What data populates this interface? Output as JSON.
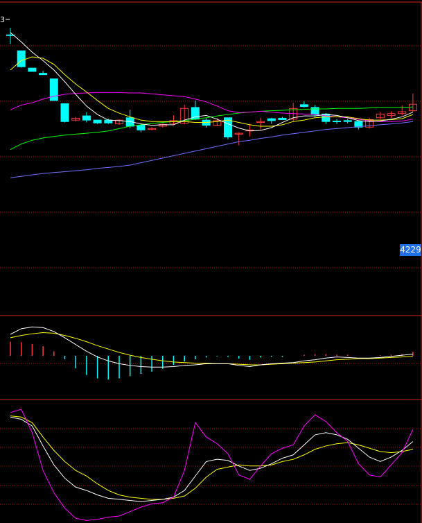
{
  "price_tag": "4229",
  "corner_glyph": "3",
  "colors": {
    "background": "#000000",
    "frame": "#d42424",
    "grid": "#a01818",
    "up_candle": "#ff3a3a",
    "down_candle": "#00ffff",
    "ma5": "#ffffff",
    "ma10": "#ffff00",
    "ma20": "#ff00ff",
    "ma30": "#00ff00",
    "ma60": "#7070ff",
    "price_tag_bg": "#1e6fe8"
  },
  "chart_data": [
    {
      "type": "candlestick",
      "panel": "main",
      "candles": [
        {
          "o": 4495,
          "h": 4510,
          "l": 4476,
          "c": 4495
        },
        {
          "o": 4461,
          "h": 4461,
          "l": 4425,
          "c": 4427
        },
        {
          "o": 4424,
          "h": 4424,
          "l": 4418,
          "c": 4417
        },
        {
          "o": 4413,
          "h": 4418,
          "l": 4410,
          "c": 4410
        },
        {
          "o": 4401,
          "h": 4401,
          "l": 4355,
          "c": 4355
        },
        {
          "o": 4348,
          "h": 4348,
          "l": 4308,
          "c": 4310
        },
        {
          "o": 4313,
          "h": 4320,
          "l": 4310,
          "c": 4317
        },
        {
          "o": 4322,
          "h": 4330,
          "l": 4308,
          "c": 4313
        },
        {
          "o": 4313,
          "h": 4313,
          "l": 4305,
          "c": 4307
        },
        {
          "o": 4313,
          "h": 4316,
          "l": 4305,
          "c": 4307
        },
        {
          "o": 4305,
          "h": 4315,
          "l": 4303,
          "c": 4313
        },
        {
          "o": 4318,
          "h": 4335,
          "l": 4296,
          "c": 4300
        },
        {
          "o": 4302,
          "h": 4305,
          "l": 4287,
          "c": 4292
        },
        {
          "o": 4293,
          "h": 4298,
          "l": 4291,
          "c": 4295
        },
        {
          "o": 4300,
          "h": 4306,
          "l": 4297,
          "c": 4304
        },
        {
          "o": 4306,
          "h": 4323,
          "l": 4302,
          "c": 4312
        },
        {
          "o": 4306,
          "h": 4346,
          "l": 4304,
          "c": 4338
        },
        {
          "o": 4340,
          "h": 4355,
          "l": 4313,
          "c": 4315
        },
        {
          "o": 4313,
          "h": 4318,
          "l": 4297,
          "c": 4302
        },
        {
          "o": 4302,
          "h": 4318,
          "l": 4300,
          "c": 4312
        },
        {
          "o": 4318,
          "h": 4318,
          "l": 4272,
          "c": 4277
        },
        {
          "o": 4283,
          "h": 4287,
          "l": 4259,
          "c": 4285
        },
        {
          "o": 4290,
          "h": 4305,
          "l": 4278,
          "c": 4292
        },
        {
          "o": 4308,
          "h": 4318,
          "l": 4293,
          "c": 4310
        },
        {
          "o": 4316,
          "h": 4318,
          "l": 4305,
          "c": 4312
        },
        {
          "o": 4317,
          "h": 4320,
          "l": 4313,
          "c": 4314
        },
        {
          "o": 4315,
          "h": 4350,
          "l": 4311,
          "c": 4338
        },
        {
          "o": 4346,
          "h": 4353,
          "l": 4340,
          "c": 4342
        },
        {
          "o": 4340,
          "h": 4345,
          "l": 4320,
          "c": 4325
        },
        {
          "o": 4326,
          "h": 4328,
          "l": 4305,
          "c": 4310
        },
        {
          "o": 4311,
          "h": 4315,
          "l": 4305,
          "c": 4310
        },
        {
          "o": 4312,
          "h": 4316,
          "l": 4306,
          "c": 4310
        },
        {
          "o": 4310,
          "h": 4312,
          "l": 4293,
          "c": 4298
        },
        {
          "o": 4298,
          "h": 4318,
          "l": 4295,
          "c": 4314
        },
        {
          "o": 4318,
          "h": 4330,
          "l": 4315,
          "c": 4326
        },
        {
          "o": 4323,
          "h": 4332,
          "l": 4318,
          "c": 4327
        },
        {
          "o": 4327,
          "h": 4344,
          "l": 4323,
          "c": 4331
        },
        {
          "o": 4333,
          "h": 4370,
          "l": 4330,
          "c": 4347
        }
      ],
      "ma5": [
        4500,
        4480,
        4458,
        4440,
        4420,
        4395,
        4368,
        4343,
        4325,
        4313,
        4312,
        4310,
        4305,
        4302,
        4303,
        4303,
        4313,
        4320,
        4323,
        4315,
        4305,
        4296,
        4290,
        4291,
        4297,
        4308,
        4318,
        4322,
        4322,
        4325,
        4323,
        4318,
        4312,
        4310,
        4311,
        4315,
        4320,
        4330
      ],
      "ma10": [
        4420,
        4440,
        4448,
        4445,
        4432,
        4410,
        4390,
        4373,
        4355,
        4338,
        4328,
        4320,
        4313,
        4310,
        4310,
        4310,
        4310,
        4308,
        4308,
        4310,
        4313,
        4308,
        4303,
        4300,
        4300,
        4303,
        4310,
        4313,
        4318,
        4320,
        4320,
        4320,
        4316,
        4313,
        4313,
        4314,
        4316,
        4325
      ],
      "ma20": [
        4335,
        4345,
        4350,
        4358,
        4364,
        4368,
        4370,
        4371,
        4372,
        4372,
        4372,
        4371,
        4371,
        4369,
        4367,
        4365,
        4363,
        4358,
        4352,
        4343,
        4333,
        4329,
        4330,
        4332,
        4330,
        4328,
        4327,
        4326,
        4325,
        4322,
        4320,
        4318,
        4315,
        4312,
        4310,
        4310,
        4311,
        4315
      ],
      "ma30": [
        4250,
        4262,
        4270,
        4275,
        4278,
        4281,
        4283,
        4285,
        4287,
        4290,
        4295,
        4300,
        4303,
        4306,
        4308,
        4310,
        4312,
        4315,
        4318,
        4322,
        4325,
        4328,
        4330,
        4332,
        4333,
        4334,
        4335,
        4336,
        4337,
        4337,
        4338,
        4338,
        4338,
        4339,
        4340,
        4340,
        4340,
        4341
      ],
      "ma60": [
        4190,
        4193,
        4196,
        4199,
        4201,
        4203,
        4205,
        4207,
        4210,
        4212,
        4214,
        4217,
        4222,
        4227,
        4232,
        4237,
        4242,
        4247,
        4252,
        4257,
        4262,
        4267,
        4270,
        4274,
        4277,
        4281,
        4284,
        4287,
        4290,
        4293,
        4295,
        4297,
        4299,
        4301,
        4303,
        4305,
        4307,
        4310
      ],
      "price_tag_value": 4229,
      "ylim": [
        4140,
        4525
      ],
      "grid": true
    },
    {
      "type": "macd",
      "panel": "middle",
      "dif": [
        3.8,
        4.8,
        5.1,
        5.0,
        4.3,
        3.2,
        2.0,
        0.8,
        -0.2,
        -0.9,
        -1.4,
        -1.7,
        -1.9,
        -2.0,
        -2.0,
        -1.9,
        -1.7,
        -1.6,
        -1.4,
        -1.4,
        -1.4,
        -1.7,
        -1.9,
        -1.6,
        -1.4,
        -1.3,
        -1.2,
        -0.9,
        -0.7,
        -0.4,
        -0.2,
        -0.3,
        -0.4,
        -0.4,
        -0.3,
        -0.1,
        0.1,
        0.3
      ],
      "dea": [
        3.2,
        3.6,
        3.9,
        4.1,
        4.0,
        3.6,
        3.1,
        2.5,
        1.8,
        1.2,
        0.6,
        0.1,
        -0.3,
        -0.6,
        -0.9,
        -1.1,
        -1.2,
        -1.3,
        -1.3,
        -1.4,
        -1.4,
        -1.5,
        -1.6,
        -1.6,
        -1.5,
        -1.4,
        -1.3,
        -1.2,
        -1.1,
        -0.9,
        -0.7,
        -0.6,
        -0.5,
        -0.5,
        -0.4,
        -0.3,
        -0.2,
        -0.1
      ],
      "macd": [
        2.5,
        2.4,
        2.1,
        1.7,
        0.8,
        -0.6,
        -2.2,
        -3.4,
        -4.0,
        -4.2,
        -4.0,
        -3.6,
        -3.2,
        -2.8,
        -2.3,
        -1.6,
        -1.0,
        -0.6,
        -0.3,
        -0.1,
        -0.2,
        -0.5,
        -0.7,
        -0.3,
        -0.2,
        -0.2,
        0.0,
        0.2,
        0.3,
        0.3,
        0.2,
        0.2,
        0.0,
        0.0,
        0.1,
        0.2,
        0.3,
        0.7
      ],
      "ylim": [
        -7,
        6.5
      ],
      "zero_line": true
    },
    {
      "type": "kdj",
      "panel": "bottom",
      "k": [
        88,
        86,
        80,
        62,
        45,
        33,
        25,
        22,
        18,
        15,
        14,
        13,
        12,
        13,
        14,
        16,
        22,
        35,
        48,
        50,
        49,
        44,
        40,
        42,
        46,
        51,
        54,
        63,
        72,
        74,
        72,
        68,
        60,
        52,
        48,
        52,
        58,
        66
      ],
      "d": [
        89,
        88,
        83,
        70,
        58,
        48,
        40,
        35,
        28,
        22,
        18,
        16,
        15,
        14,
        14,
        15,
        17,
        24,
        34,
        41,
        43,
        45,
        44,
        44,
        45,
        48,
        50,
        54,
        59,
        62,
        64,
        65,
        63,
        60,
        57,
        56,
        57,
        59
      ],
      "j": [
        92,
        95,
        74,
        40,
        20,
        6,
        -3,
        -5,
        -4,
        -2,
        -1,
        3,
        7,
        10,
        11,
        16,
        40,
        83,
        70,
        64,
        55,
        36,
        32,
        44,
        55,
        60,
        63,
        80,
        90,
        84,
        74,
        66,
        46,
        36,
        34,
        45,
        56,
        77
      ],
      "ylim": [
        -6,
        100
      ],
      "grid": true
    }
  ]
}
